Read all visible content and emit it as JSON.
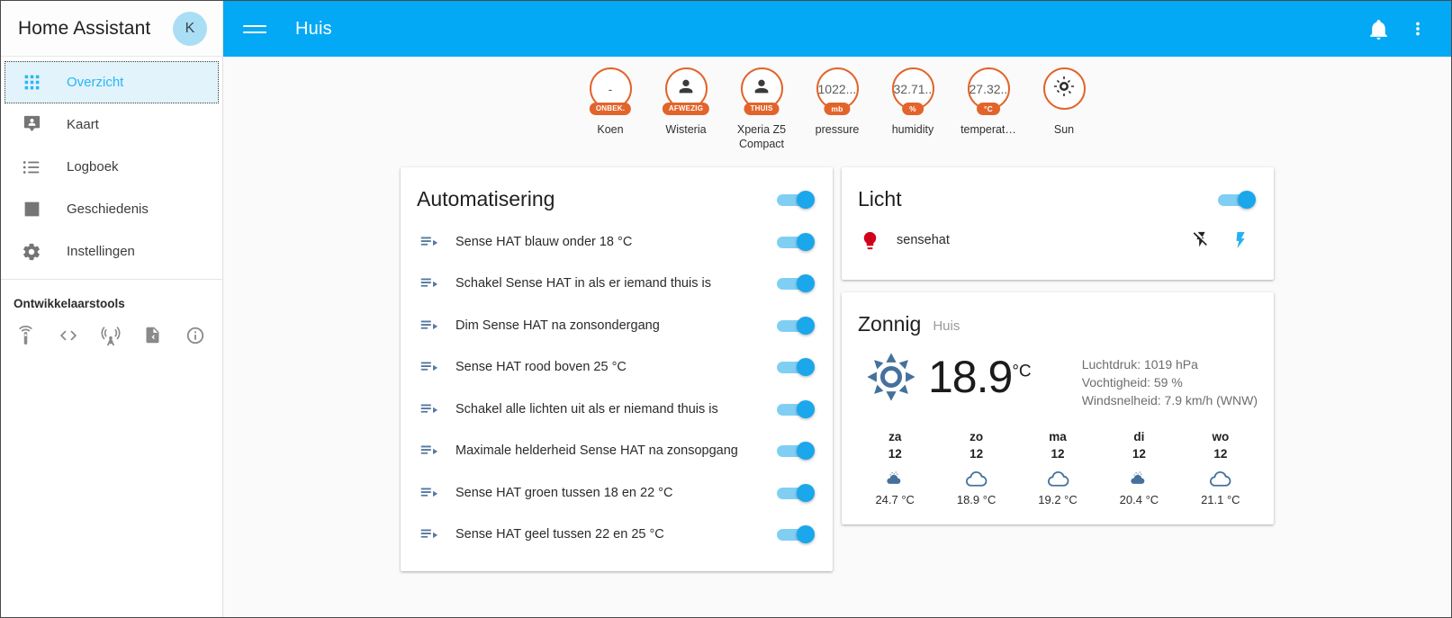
{
  "sidebar": {
    "title": "Home Assistant",
    "avatar_initial": "K",
    "items": [
      {
        "label": "Overzicht",
        "icon": "view-dashboard-icon",
        "active": true
      },
      {
        "label": "Kaart",
        "icon": "map-marker-account-icon",
        "active": false
      },
      {
        "label": "Logboek",
        "icon": "format-list-bulleted-icon",
        "active": false
      },
      {
        "label": "Geschiedenis",
        "icon": "chart-box-icon",
        "active": false
      },
      {
        "label": "Instellingen",
        "icon": "cog-icon",
        "active": false
      }
    ],
    "devtools_label": "Ontwikkelaarstools",
    "devtools_icons": [
      "remote-icon",
      "code-tags-icon",
      "broadcast-icon",
      "file-code-icon",
      "information-outline-icon"
    ]
  },
  "appbar": {
    "menu_icon": "hamburger-menu-icon",
    "title": "Huis",
    "bell_icon": "bell-icon",
    "overflow_icon": "dots-vertical-icon",
    "background": "#03a9f4"
  },
  "badges": [
    {
      "value": "-",
      "chip": "ONBEK.",
      "name": "Koen",
      "icon": null,
      "chip_color": "#e2642b"
    },
    {
      "value": null,
      "chip": "AFWEZIG",
      "name": "Wisteria",
      "icon": "person-icon",
      "chip_color": "#e2642b"
    },
    {
      "value": null,
      "chip": "THUIS",
      "name": "Xperia Z5 Compact",
      "icon": "person-icon",
      "chip_color": "#e2642b"
    },
    {
      "value": "1022....",
      "chip": "mb",
      "name": "pressure",
      "icon": null,
      "chip_color": "#e2642b"
    },
    {
      "value": "32.71...",
      "chip": "%",
      "name": "humidity",
      "icon": null,
      "chip_color": "#e2642b"
    },
    {
      "value": "27.32...",
      "chip": "°C",
      "name": "temperat…",
      "icon": null,
      "chip_color": "#e2642b"
    },
    {
      "value": null,
      "chip": null,
      "name": "Sun",
      "icon": "sun-icon",
      "chip_color": "#e2642b"
    }
  ],
  "automation_card": {
    "title": "Automatisering",
    "master_toggle": true,
    "rows": [
      {
        "name": "Sense HAT blauw onder 18 °C",
        "on": true
      },
      {
        "name": "Schakel Sense HAT in als er iemand thuis is",
        "on": true
      },
      {
        "name": "Dim Sense HAT na zonsondergang",
        "on": true
      },
      {
        "name": "Sense HAT rood boven 25 °C",
        "on": true
      },
      {
        "name": "Schakel alle lichten uit als er niemand thuis is",
        "on": true
      },
      {
        "name": "Maximale helderheid Sense HAT na zonsopgang",
        "on": true
      },
      {
        "name": "Sense HAT groen tussen 18 en 22 °C",
        "on": true
      },
      {
        "name": "Sense HAT geel tussen 22 en 25 °C",
        "on": true
      }
    ]
  },
  "light_card": {
    "title": "Licht",
    "master_toggle": true,
    "rows": [
      {
        "name": "sensehat",
        "bulb_color": "#d0021b",
        "actions": [
          "flash-off-icon",
          "flash-icon"
        ]
      }
    ]
  },
  "weather_card": {
    "title": "Zonnig",
    "subtitle": "Huis",
    "condition_icon": "weather-sunny-icon",
    "temperature": "18.9",
    "temperature_unit": "°C",
    "attributes": [
      "Luchtdruk: 1019 hPa",
      "Vochtigheid: 59 %",
      "Windsnelheid: 7.9 km/h (WNW)"
    ],
    "forecast": [
      {
        "day": "za",
        "date": "12",
        "icon": "weather-partly-cloudy-icon",
        "temp": "24.7 °C"
      },
      {
        "day": "zo",
        "date": "12",
        "icon": "weather-cloudy-icon",
        "temp": "18.9 °C"
      },
      {
        "day": "ma",
        "date": "12",
        "icon": "weather-cloudy-icon",
        "temp": "19.2 °C"
      },
      {
        "day": "di",
        "date": "12",
        "icon": "weather-partly-cloudy-icon",
        "temp": "20.4 °C"
      },
      {
        "day": "wo",
        "date": "12",
        "icon": "weather-cloudy-icon",
        "temp": "21.1 °C"
      }
    ]
  },
  "colors": {
    "accent": "#03a9f4",
    "badge_orange": "#e2642b",
    "bulb_red": "#d0021b",
    "weather_blue": "#45719c",
    "sidebar_active_bg": "#e2f3fb"
  }
}
